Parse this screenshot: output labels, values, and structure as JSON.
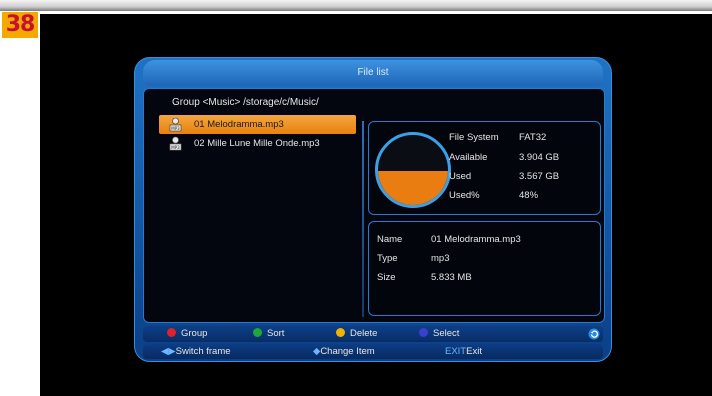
{
  "badge": "38",
  "window": {
    "title": "File list",
    "path": "Group <Music>  /storage/c/Music/"
  },
  "files": [
    {
      "label": "01 Melodramma.mp3",
      "icon": "mp3-file-icon",
      "selected": true
    },
    {
      "label": "02 Mille Lune Mille Onde.mp3",
      "icon": "mp3-file-icon",
      "selected": false
    }
  ],
  "storage": {
    "used_fraction": 0.48,
    "file_system_label": "File System",
    "file_system_value": "FAT32",
    "available_label": "Available",
    "available_value": "3.904 GB",
    "used_label": "Used",
    "used_value": "3.567 GB",
    "used_pct_label": "Used%",
    "used_pct_value": "48%",
    "pie_fill_color": "#ea7d12"
  },
  "details": {
    "name_label": "Name",
    "name_value": "01 Melodramma.mp3",
    "type_label": "Type",
    "type_value": "mp3",
    "size_label": "Size",
    "size_value": "5.833 MB"
  },
  "color_keys": [
    {
      "label": "Group",
      "color": "#e0202a"
    },
    {
      "label": "Sort",
      "color": "#1fa83a"
    },
    {
      "label": "Delete",
      "color": "#f0b400"
    },
    {
      "label": "Select",
      "color": "#3b3fc9"
    }
  ],
  "hints": {
    "switch_key": "◀▶",
    "switch_label": "Switch frame",
    "change_key": "◆",
    "change_label": "Change Item",
    "exit_key": "EXIT",
    "exit_label": "Exit"
  }
}
